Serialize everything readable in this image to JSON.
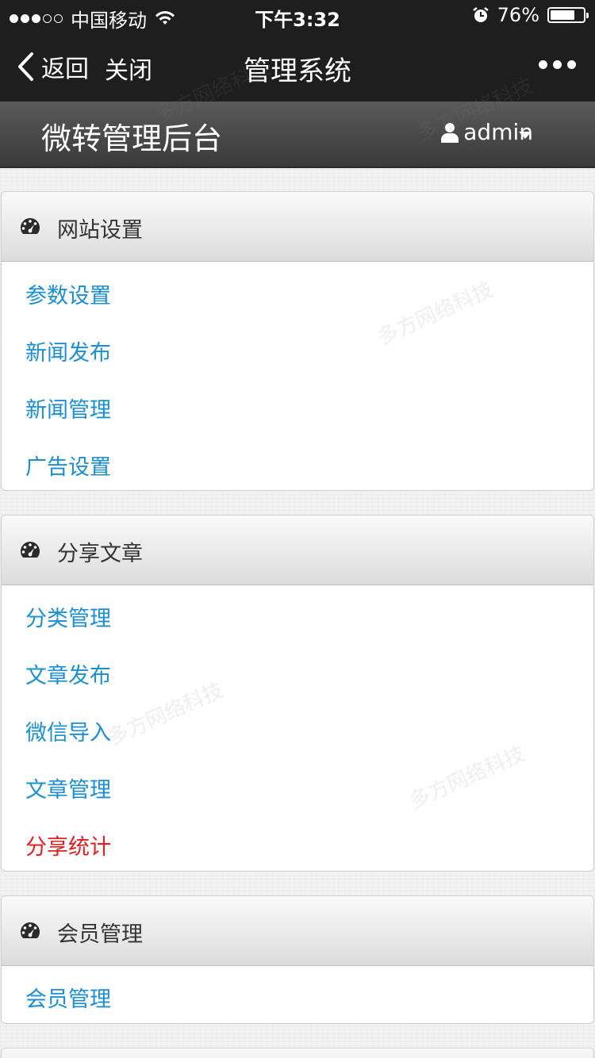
{
  "status_bar": {
    "carrier": "中国移动",
    "time": "下午3:32",
    "battery": "76%",
    "battery_level": 0.76,
    "signal_bars_filled": 3,
    "signal_bars_total": 5
  },
  "nav": {
    "back_label": "返回",
    "close_label": "关闭",
    "title": "管理系统",
    "more_icon": "more-dots-icon"
  },
  "header": {
    "title": "微转管理后台",
    "user": "admin",
    "user_icon": "user-icon",
    "caret_icon": "caret-down-icon"
  },
  "panels": [
    {
      "title": "网站设置",
      "icon": "dashboard-icon",
      "items": [
        {
          "label": "参数设置"
        },
        {
          "label": "新闻发布"
        },
        {
          "label": "新闻管理"
        },
        {
          "label": "广告设置"
        }
      ]
    },
    {
      "title": "分享文章",
      "icon": "dashboard-icon",
      "items": [
        {
          "label": "分类管理"
        },
        {
          "label": "文章发布"
        },
        {
          "label": "微信导入"
        },
        {
          "label": "文章管理"
        },
        {
          "label": "分享统计",
          "active": true
        }
      ]
    },
    {
      "title": "会员管理",
      "icon": "dashboard-icon",
      "items": [
        {
          "label": "会员管理"
        }
      ]
    }
  ],
  "watermark_text": "多方网络科技",
  "colors": {
    "bar_bg": "#1e1e1e",
    "link": "#1b8fd4",
    "active_link": "#e02020",
    "header_dark": "#3a3a3a"
  }
}
